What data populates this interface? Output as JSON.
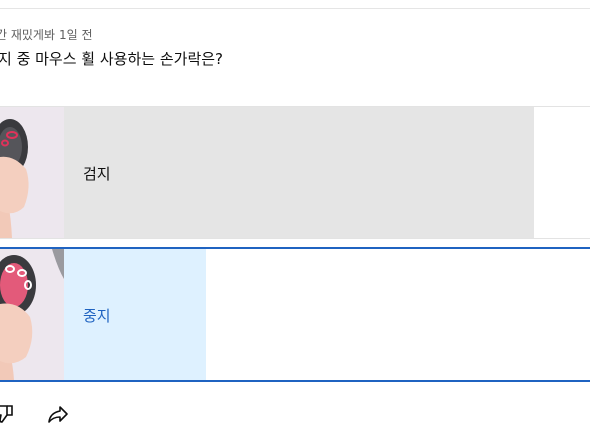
{
  "post": {
    "author": "간 재밌게봐",
    "time": "1일 전",
    "question": "지 중 마우스 휠 사용하는 손가락은?"
  },
  "poll": {
    "options": [
      {
        "label": "검지",
        "selected": false,
        "result_fraction": 0.8
      },
      {
        "label": "중지",
        "selected": true,
        "result_fraction": 0.25
      }
    ],
    "colors": {
      "selected_border": "#1f63c1",
      "selected_fill": "#def1ff",
      "unselected_fill": "#e5e5e5"
    }
  },
  "actions": {
    "dislike_icon": "thumbs-down-icon",
    "share_icon": "share-icon"
  }
}
